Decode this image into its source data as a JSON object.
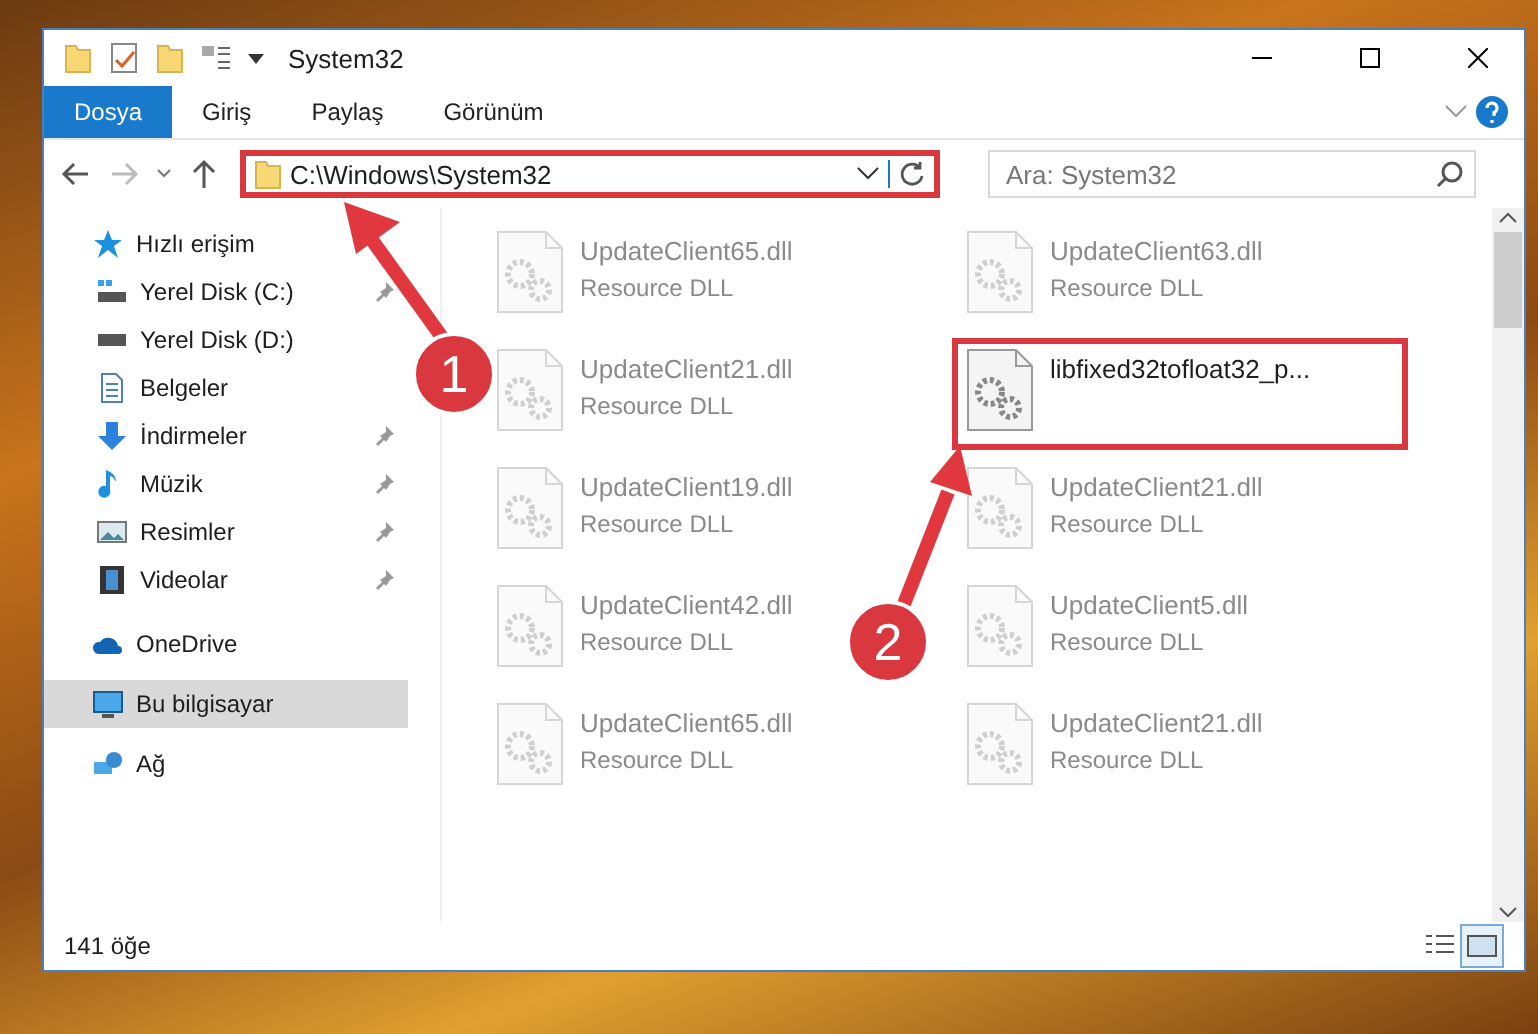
{
  "window": {
    "title": "System32"
  },
  "ribbon_tabs": [
    {
      "label": "Dosya",
      "selected": true
    },
    {
      "label": "Giriş",
      "selected": false
    },
    {
      "label": "Paylaş",
      "selected": false
    },
    {
      "label": "Görünüm",
      "selected": false
    }
  ],
  "address": {
    "path": "C:\\Windows\\System32",
    "highlighted": true
  },
  "search": {
    "placeholder": "Ara: System32"
  },
  "sidebar": {
    "items": [
      {
        "label": "Hızlı erişim",
        "kind": "star",
        "selected": false,
        "children": [
          {
            "label": "Yerel Disk (C:)",
            "kind": "drive-c",
            "pinned": true,
            "selected": false
          },
          {
            "label": "Yerel Disk (D:)",
            "kind": "drive",
            "pinned": false,
            "selected": false
          },
          {
            "label": "Belgeler",
            "kind": "document",
            "pinned": false,
            "selected": false
          },
          {
            "label": "İndirmeler",
            "kind": "download",
            "pinned": true,
            "selected": false
          },
          {
            "label": "Müzik",
            "kind": "music",
            "pinned": true,
            "selected": false
          },
          {
            "label": "Resimler",
            "kind": "pictures",
            "pinned": true,
            "selected": false
          },
          {
            "label": "Videolar",
            "kind": "video",
            "pinned": true,
            "selected": false
          }
        ]
      },
      {
        "label": "OneDrive",
        "kind": "cloud",
        "selected": false
      },
      {
        "label": "Bu bilgisayar",
        "kind": "computer",
        "selected": true
      },
      {
        "label": "Ağ",
        "kind": "network",
        "selected": false
      }
    ]
  },
  "files": [
    {
      "name": "UpdateClient65.dll",
      "type": "Resource DLL",
      "dimmed": true,
      "highlighted": false
    },
    {
      "name": "UpdateClient63.dll",
      "type": "Resource DLL",
      "dimmed": true,
      "highlighted": false
    },
    {
      "name": "UpdateClient21.dll",
      "type": "Resource DLL",
      "dimmed": true,
      "highlighted": false
    },
    {
      "name": "libfixed32tofloat32_p...",
      "dimmed": false,
      "highlighted": true
    },
    {
      "name": "UpdateClient19.dll",
      "type": "Resource DLL",
      "dimmed": true,
      "highlighted": false
    },
    {
      "name": "UpdateClient21.dll",
      "type": "Resource DLL",
      "dimmed": true,
      "highlighted": false
    },
    {
      "name": "UpdateClient42.dll",
      "type": "Resource DLL",
      "dimmed": true,
      "highlighted": false
    },
    {
      "name": "UpdateClient5.dll",
      "type": "Resource DLL",
      "dimmed": true,
      "highlighted": false
    },
    {
      "name": "UpdateClient65.dll",
      "type": "Resource DLL",
      "dimmed": true,
      "highlighted": false
    },
    {
      "name": "UpdateClient21.dll",
      "type": "Resource DLL",
      "dimmed": true,
      "highlighted": false
    }
  ],
  "callouts": [
    {
      "number": "1"
    },
    {
      "number": "2"
    }
  ],
  "status_bar": {
    "count": "141 öğe"
  }
}
